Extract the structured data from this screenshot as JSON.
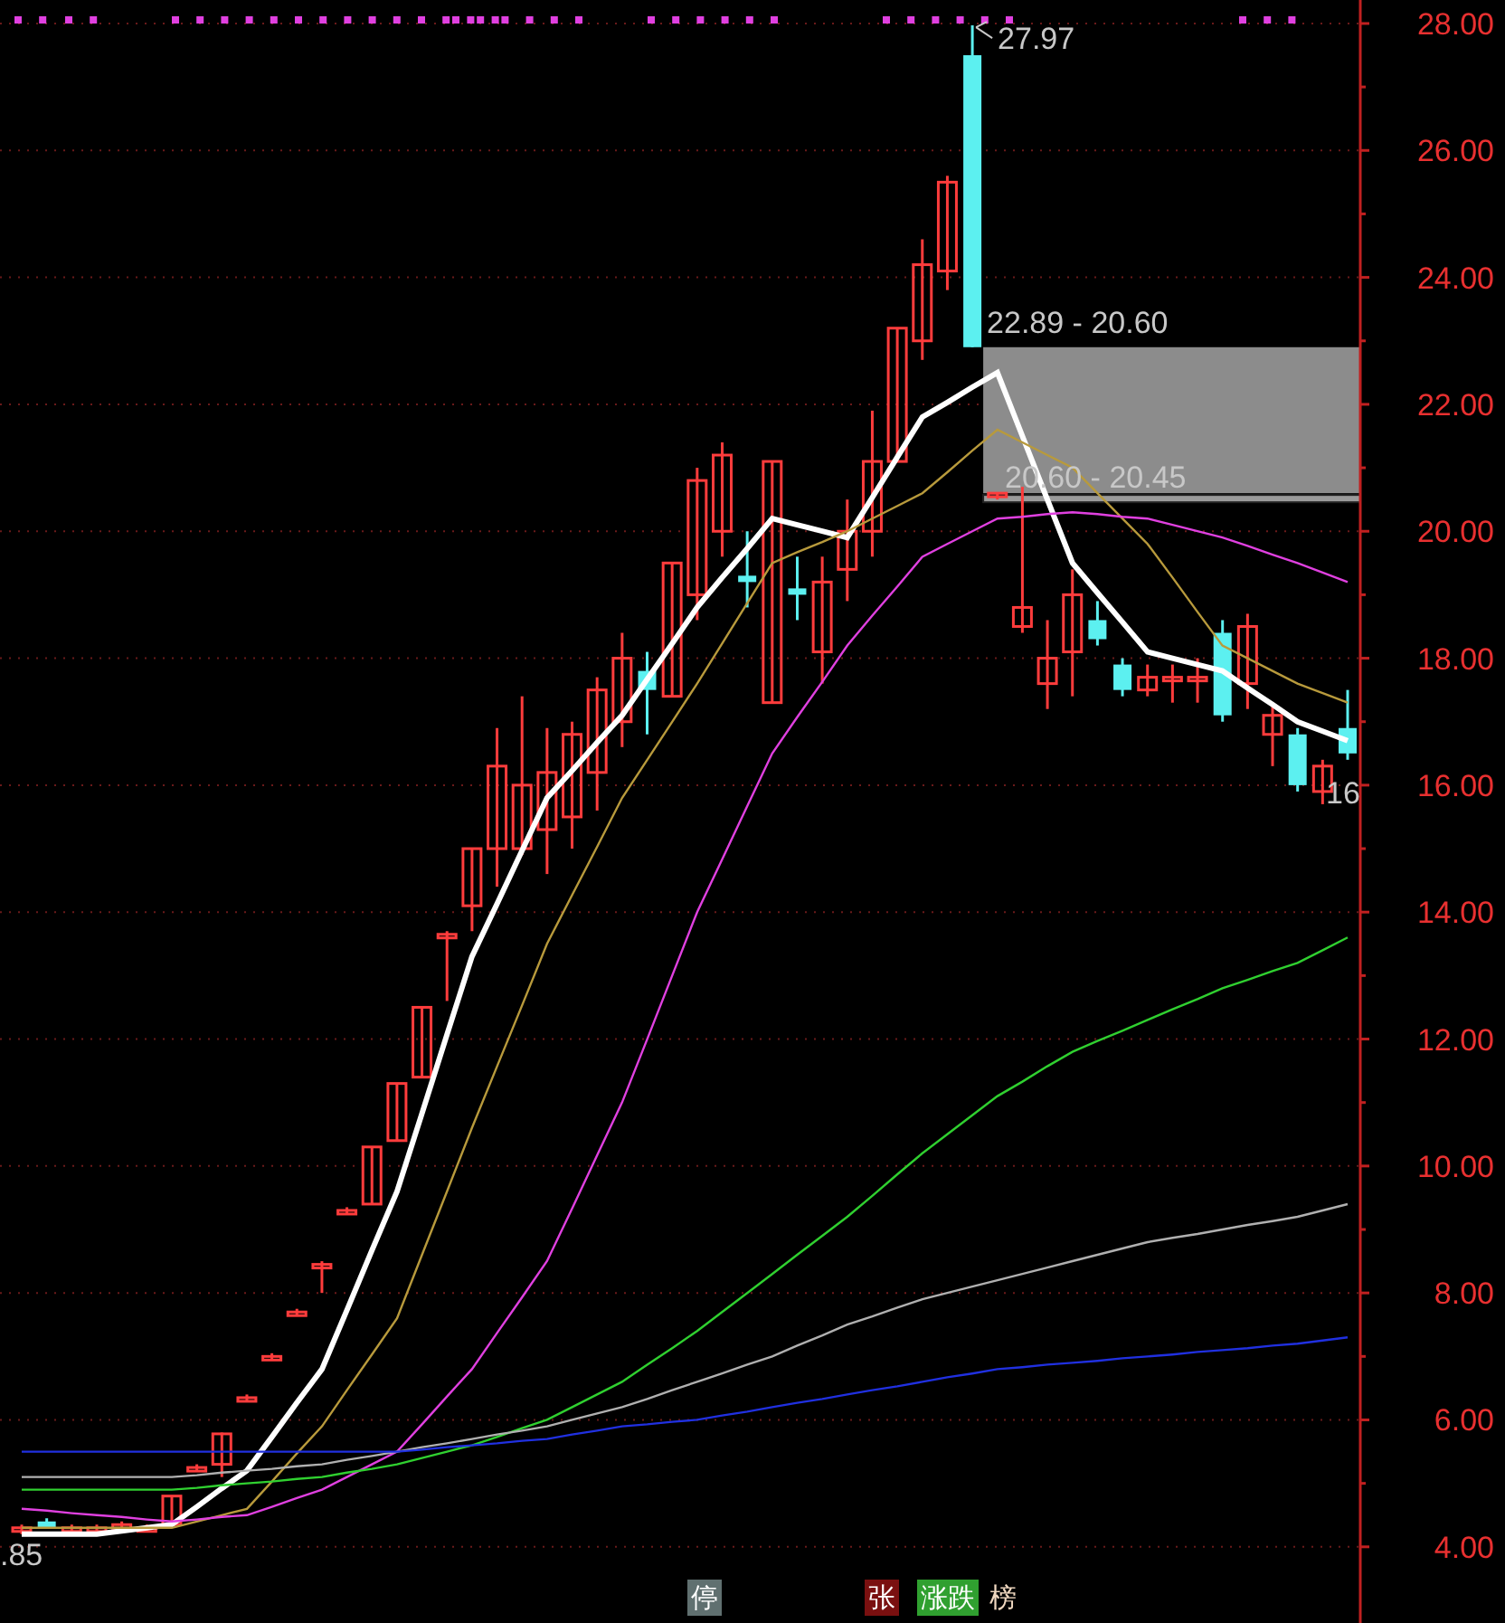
{
  "chart_data": {
    "type": "candlestick",
    "grid": true,
    "ylim": [
      2.8,
      28.37
    ],
    "yticks": [
      {
        "value": 28,
        "label": "28.00"
      },
      {
        "value": 26,
        "label": "26.00"
      },
      {
        "value": 24,
        "label": "24.00"
      },
      {
        "value": 22,
        "label": "22.00"
      },
      {
        "value": 20,
        "label": "20.00"
      },
      {
        "value": 18,
        "label": "18.00"
      },
      {
        "value": 16,
        "label": "16.00"
      },
      {
        "value": 14,
        "label": "14.00"
      },
      {
        "value": 12,
        "label": "12.00"
      },
      {
        "value": 10,
        "label": "10.00"
      },
      {
        "value": 8,
        "label": "8.00"
      },
      {
        "value": 6,
        "label": "6.00"
      },
      {
        "value": 4,
        "label": "4.00"
      }
    ],
    "ohlc": [
      [
        4.25,
        4.35,
        4.2,
        4.3
      ],
      [
        4.4,
        4.45,
        4.3,
        4.3
      ],
      [
        4.25,
        4.35,
        4.2,
        4.3
      ],
      [
        4.3,
        4.35,
        4.25,
        4.3
      ],
      [
        4.3,
        4.4,
        4.25,
        4.35
      ],
      [
        4.3,
        4.35,
        4.25,
        4.3
      ],
      [
        4.35,
        4.8,
        4.35,
        4.8
      ],
      [
        5.25,
        5.3,
        5.2,
        5.25
      ],
      [
        5.3,
        5.8,
        5.1,
        5.78
      ],
      [
        6.35,
        6.4,
        6.3,
        6.35
      ],
      [
        7.0,
        7.05,
        6.95,
        7.0
      ],
      [
        7.7,
        7.75,
        7.65,
        7.7
      ],
      [
        8.4,
        8.5,
        8.0,
        8.45
      ],
      [
        9.3,
        9.35,
        9.25,
        9.3
      ],
      [
        9.4,
        10.3,
        9.4,
        10.3
      ],
      [
        10.4,
        11.3,
        10.4,
        11.3
      ],
      [
        11.4,
        12.5,
        11.4,
        12.5
      ],
      [
        13.6,
        13.7,
        12.6,
        13.65
      ],
      [
        14.1,
        15.0,
        13.7,
        15.0
      ],
      [
        15.0,
        16.9,
        14.4,
        16.3
      ],
      [
        15.0,
        17.4,
        14.9,
        16.0
      ],
      [
        15.3,
        16.9,
        14.6,
        16.2
      ],
      [
        15.5,
        17.0,
        15.0,
        16.8
      ],
      [
        16.2,
        17.7,
        15.6,
        17.5
      ],
      [
        17.0,
        18.4,
        16.6,
        18.0
      ],
      [
        17.8,
        18.1,
        16.8,
        17.5
      ],
      [
        17.4,
        19.5,
        17.4,
        19.5
      ],
      [
        19.0,
        21.0,
        18.6,
        20.8
      ],
      [
        20.0,
        21.4,
        19.6,
        21.2
      ],
      [
        19.3,
        20.0,
        18.8,
        19.2
      ],
      [
        17.3,
        21.1,
        17.3,
        21.1
      ],
      [
        19.1,
        19.6,
        18.6,
        19.0
      ],
      [
        18.1,
        19.6,
        17.6,
        19.2
      ],
      [
        19.4,
        20.5,
        18.9,
        20.0
      ],
      [
        20.0,
        21.9,
        19.6,
        21.1
      ],
      [
        21.1,
        23.2,
        21.1,
        23.2
      ],
      [
        23.0,
        24.6,
        22.7,
        24.2
      ],
      [
        24.1,
        25.6,
        23.8,
        25.5
      ],
      [
        27.5,
        27.97,
        22.9,
        22.9
      ],
      [
        20.55,
        20.6,
        20.5,
        20.6
      ],
      [
        18.5,
        20.7,
        18.4,
        18.8
      ],
      [
        17.6,
        18.6,
        17.2,
        18.0
      ],
      [
        18.1,
        19.4,
        17.4,
        19.0
      ],
      [
        18.6,
        18.9,
        18.2,
        18.3
      ],
      [
        17.9,
        18.0,
        17.4,
        17.5
      ],
      [
        17.5,
        17.9,
        17.4,
        17.7
      ],
      [
        17.7,
        17.9,
        17.3,
        17.7
      ],
      [
        17.7,
        18.0,
        17.3,
        17.7
      ],
      [
        18.4,
        18.6,
        17.0,
        17.1
      ],
      [
        17.6,
        18.7,
        17.2,
        18.5
      ],
      [
        16.8,
        17.3,
        16.3,
        17.1
      ],
      [
        16.8,
        16.9,
        15.9,
        16.0
      ],
      [
        15.9,
        16.4,
        15.7,
        16.3
      ],
      [
        16.9,
        17.5,
        16.4,
        16.5
      ]
    ],
    "series": [
      {
        "type": "line",
        "color": "#ffffff",
        "values": [
          4.2,
          4.2,
          4.2,
          4.2,
          4.25,
          4.3,
          4.35,
          4.63,
          4.92,
          5.2,
          5.73,
          6.27,
          6.8,
          7.73,
          8.67,
          9.6,
          10.83,
          12.07,
          13.3,
          14.13,
          14.97,
          15.8,
          16.23,
          16.67,
          17.1,
          17.67,
          18.23,
          18.8,
          19.27,
          19.73,
          20.2,
          20.1,
          20.0,
          19.9,
          20.53,
          21.17,
          21.8,
          22.03,
          22.27,
          22.5,
          21.5,
          20.5,
          19.5,
          19.03,
          18.57,
          18.1,
          18.0,
          17.9,
          17.8,
          17.53,
          17.27,
          17.0,
          16.85,
          16.7
        ]
      },
      {
        "type": "line",
        "color": "#b89a3c",
        "values": [
          4.3,
          4.3,
          4.3,
          4.3,
          4.3,
          4.3,
          4.3,
          4.4,
          4.5,
          4.6,
          5.03,
          5.47,
          5.9,
          6.47,
          7.03,
          7.6,
          8.6,
          9.6,
          10.6,
          11.57,
          12.53,
          13.5,
          14.27,
          15.03,
          15.8,
          16.4,
          17.0,
          17.6,
          18.23,
          18.87,
          19.5,
          19.67,
          19.83,
          20.0,
          20.2,
          20.4,
          20.6,
          20.93,
          21.27,
          21.6,
          21.4,
          21.2,
          21.0,
          20.6,
          20.2,
          19.8,
          19.27,
          18.73,
          18.2,
          18.0,
          17.8,
          17.6,
          17.45,
          17.3
        ]
      },
      {
        "type": "line",
        "color": "#e040e0",
        "values": [
          4.6,
          4.57,
          4.53,
          4.5,
          4.47,
          4.43,
          4.4,
          4.43,
          4.47,
          4.5,
          4.63,
          4.77,
          4.9,
          5.1,
          5.3,
          5.5,
          5.93,
          6.37,
          6.8,
          7.37,
          7.93,
          8.5,
          9.33,
          10.17,
          11.0,
          12.0,
          13.0,
          14.0,
          14.83,
          15.67,
          16.5,
          17.07,
          17.63,
          18.2,
          18.67,
          19.13,
          19.6,
          19.8,
          20.0,
          20.2,
          20.23,
          20.27,
          20.3,
          20.27,
          20.23,
          20.2,
          20.1,
          20.0,
          19.9,
          19.77,
          19.63,
          19.5,
          19.35,
          19.2
        ]
      },
      {
        "type": "line",
        "color": "#30d030",
        "values": [
          4.9,
          4.9,
          4.9,
          4.9,
          4.9,
          4.9,
          4.9,
          4.93,
          4.97,
          5.0,
          5.03,
          5.07,
          5.1,
          5.17,
          5.23,
          5.3,
          5.4,
          5.5,
          5.6,
          5.73,
          5.87,
          6.0,
          6.2,
          6.4,
          6.6,
          6.87,
          7.13,
          7.4,
          7.7,
          8.0,
          8.3,
          8.6,
          8.9,
          9.2,
          9.53,
          9.87,
          10.2,
          10.5,
          10.8,
          11.1,
          11.33,
          11.57,
          11.8,
          11.97,
          12.13,
          12.3,
          12.47,
          12.63,
          12.8,
          12.93,
          13.07,
          13.2,
          13.4,
          13.6
        ]
      },
      {
        "type": "line",
        "color": "#b0b0b0",
        "values": [
          5.1,
          5.1,
          5.1,
          5.1,
          5.1,
          5.1,
          5.1,
          5.13,
          5.17,
          5.2,
          5.23,
          5.27,
          5.3,
          5.37,
          5.43,
          5.5,
          5.57,
          5.63,
          5.7,
          5.77,
          5.83,
          5.9,
          6.0,
          6.1,
          6.2,
          6.33,
          6.47,
          6.6,
          6.73,
          6.87,
          7.0,
          7.17,
          7.33,
          7.5,
          7.63,
          7.77,
          7.9,
          8.0,
          8.1,
          8.2,
          8.3,
          8.4,
          8.5,
          8.6,
          8.7,
          8.8,
          8.87,
          8.93,
          9.0,
          9.07,
          9.13,
          9.2,
          9.3,
          9.4
        ]
      },
      {
        "type": "line",
        "color": "#2030e0",
        "values": [
          5.5,
          5.5,
          5.5,
          5.5,
          5.5,
          5.5,
          5.5,
          5.5,
          5.5,
          5.5,
          5.5,
          5.5,
          5.5,
          5.5,
          5.5,
          5.5,
          5.53,
          5.57,
          5.6,
          5.63,
          5.67,
          5.7,
          5.77,
          5.83,
          5.9,
          5.93,
          5.97,
          6.0,
          6.07,
          6.13,
          6.2,
          6.27,
          6.33,
          6.4,
          6.47,
          6.53,
          6.6,
          6.67,
          6.73,
          6.8,
          6.83,
          6.87,
          6.9,
          6.93,
          6.97,
          7.0,
          7.03,
          7.07,
          7.1,
          7.13,
          7.17,
          7.2,
          7.25,
          7.3
        ]
      }
    ],
    "annotations": [
      "27.97",
      "22.89 - 20.60",
      "20.60 - 20.45",
      "16",
      ".85"
    ]
  },
  "event_tags": [
    {
      "text": "停",
      "kind": "grey"
    },
    {
      "text": "张",
      "kind": "red"
    },
    {
      "text": "涨跌",
      "kind": "green"
    },
    {
      "text": "榜",
      "kind": "plain"
    }
  ]
}
